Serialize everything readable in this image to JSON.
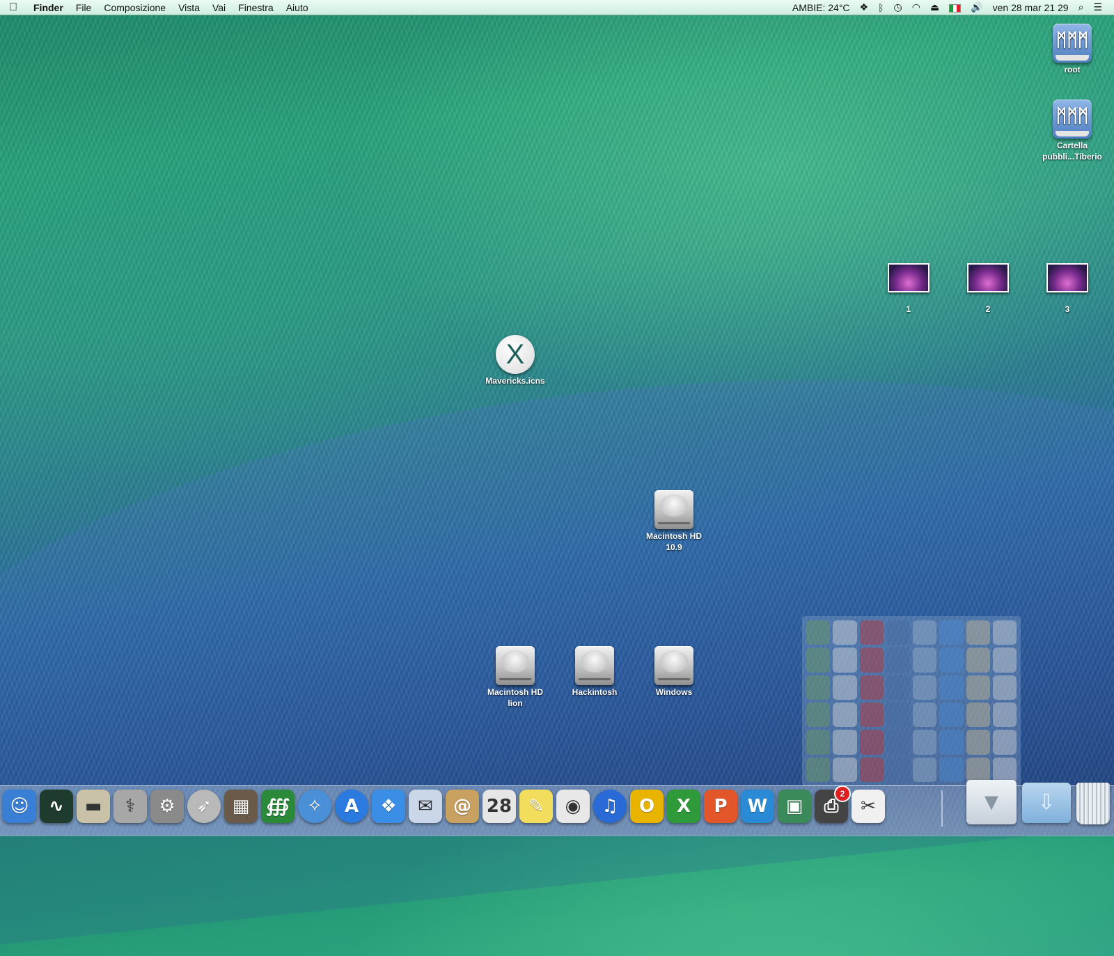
{
  "menubar": {
    "apple_icon": "",
    "menus": [
      "Finder",
      "File",
      "Composizione",
      "Vista",
      "Vai",
      "Finestra",
      "Aiuto"
    ],
    "status": {
      "weather": "AMBIE: 24°C",
      "dropbox_icon": "dropbox-icon",
      "bluetooth_icon": "bluetooth-icon",
      "time_machine_icon": "time-machine-icon",
      "wifi_icon": "wifi-icon",
      "eject_icon": "eject-icon",
      "volume_icon": "volume-icon",
      "datetime": "ven 28 mar  21 29",
      "spotlight_icon": "spotlight-icon",
      "notification_icon": "notification-center-icon"
    }
  },
  "desktop": {
    "shares": [
      {
        "label": "root"
      },
      {
        "label": "Cartella pubbli...Tiberio"
      }
    ],
    "thumbnails": [
      {
        "label": "1"
      },
      {
        "label": "2"
      },
      {
        "label": "3"
      }
    ],
    "mavericks": {
      "label": "Mavericks.icns",
      "glyph": "X"
    },
    "drives": [
      {
        "label": "Macintosh HD 10.9"
      },
      {
        "label": "Macintosh HD lion"
      },
      {
        "label": "Hackintosh"
      },
      {
        "label": "Windows"
      }
    ]
  },
  "dock": {
    "items": [
      {
        "name": "finder",
        "glyph": "☺",
        "color": "#3a7fd6"
      },
      {
        "name": "activity-monitor",
        "glyph": "∿",
        "color": "#1f3b2e"
      },
      {
        "name": "drive-utility",
        "glyph": "▬",
        "color": "#c9c2a8"
      },
      {
        "name": "disk-utility",
        "glyph": "⚕",
        "color": "#a7a7a7"
      },
      {
        "name": "system-preferences",
        "glyph": "⚙",
        "color": "#8a8a8a"
      },
      {
        "name": "launchpad",
        "glyph": "➶",
        "color": "#b9b9b9"
      },
      {
        "name": "image-capture",
        "glyph": "▦",
        "color": "#6a5a4a"
      },
      {
        "name": "istat",
        "glyph": "∰",
        "color": "#2a8a3a"
      },
      {
        "name": "safari",
        "glyph": "✧",
        "color": "#4a90d9"
      },
      {
        "name": "app-store",
        "glyph": "A",
        "color": "#2a7ae0"
      },
      {
        "name": "dropbox",
        "glyph": "❖",
        "color": "#3a8ee6"
      },
      {
        "name": "mail",
        "glyph": "✉",
        "color": "#c9d7e8"
      },
      {
        "name": "contacts",
        "glyph": "@",
        "color": "#c8a060"
      },
      {
        "name": "calendar",
        "glyph": "28",
        "color": "#e6e6e6"
      },
      {
        "name": "stickies",
        "glyph": "✎",
        "color": "#f3dd5c"
      },
      {
        "name": "preview",
        "glyph": "◉",
        "color": "#e8e8e8"
      },
      {
        "name": "itunes",
        "glyph": "♫",
        "color": "#2a6ad6"
      },
      {
        "name": "outlook",
        "glyph": "O",
        "color": "#e8b400"
      },
      {
        "name": "excel",
        "glyph": "X",
        "color": "#2e9a3a"
      },
      {
        "name": "powerpoint",
        "glyph": "P",
        "color": "#e2562a"
      },
      {
        "name": "word",
        "glyph": "W",
        "color": "#2a8ad6"
      },
      {
        "name": "photo-app",
        "glyph": "▣",
        "color": "#3a8a5a"
      },
      {
        "name": "printer",
        "glyph": "⎙",
        "color": "#444444",
        "badge": "2"
      },
      {
        "name": "grab",
        "glyph": "✂",
        "color": "#f0f0f0"
      }
    ],
    "stack_icon": "chevron-down-icon",
    "downloads_icon": "downloads-folder-icon",
    "trash_icon": "trash-icon"
  }
}
